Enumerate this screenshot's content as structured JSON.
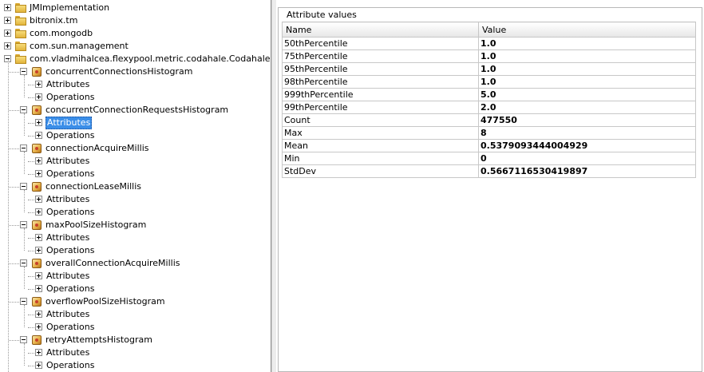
{
  "tree": {
    "packages": [
      {
        "label": "JMImplementation"
      },
      {
        "label": "bitronix.tm"
      },
      {
        "label": "com.mongodb"
      },
      {
        "label": "com.sun.management"
      },
      {
        "label": "com.vladmihalcea.flexypool.metric.codahale.CodahaleMetrics."
      }
    ],
    "beans": [
      {
        "label": "concurrentConnectionsHistogram",
        "attributes": "Attributes",
        "operations": "Operations"
      },
      {
        "label": "concurrentConnectionRequestsHistogram",
        "attributes": "Attributes",
        "operations": "Operations",
        "selected": "attributes"
      },
      {
        "label": "connectionAcquireMillis",
        "attributes": "Attributes",
        "operations": "Operations"
      },
      {
        "label": "connectionLeaseMillis",
        "attributes": "Attributes",
        "operations": "Operations"
      },
      {
        "label": "maxPoolSizeHistogram",
        "attributes": "Attributes",
        "operations": "Operations"
      },
      {
        "label": "overallConnectionAcquireMillis",
        "attributes": "Attributes",
        "operations": "Operations"
      },
      {
        "label": "overflowPoolSizeHistogram",
        "attributes": "Attributes",
        "operations": "Operations"
      },
      {
        "label": "retryAttemptsHistogram",
        "attributes": "Attributes",
        "operations": "Operations"
      }
    ]
  },
  "attributes": {
    "title": "Attribute values",
    "columns": {
      "name": "Name",
      "value": "Value"
    },
    "rows": [
      {
        "name": "50thPercentile",
        "value": "1.0"
      },
      {
        "name": "75thPercentile",
        "value": "1.0"
      },
      {
        "name": "95thPercentile",
        "value": "1.0"
      },
      {
        "name": "98thPercentile",
        "value": "1.0"
      },
      {
        "name": "999thPercentile",
        "value": "5.0"
      },
      {
        "name": "99thPercentile",
        "value": "2.0"
      },
      {
        "name": "Count",
        "value": "477550"
      },
      {
        "name": "Max",
        "value": "8"
      },
      {
        "name": "Mean",
        "value": "0.5379093444004929"
      },
      {
        "name": "Min",
        "value": "0"
      },
      {
        "name": "StdDev",
        "value": "0.5667116530419897"
      }
    ]
  }
}
